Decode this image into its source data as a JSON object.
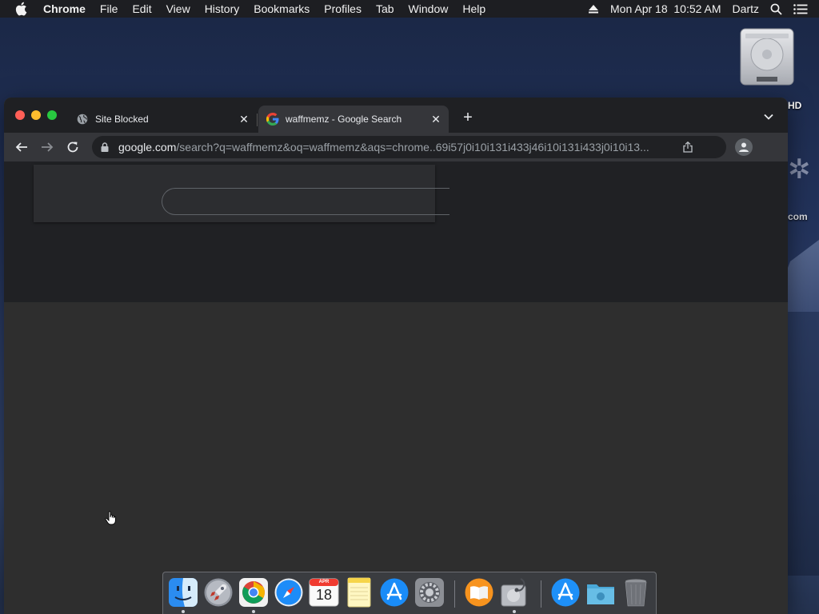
{
  "menubar": {
    "apple_icon": "apple-logo-icon",
    "items": [
      {
        "label": "Chrome",
        "app": true
      },
      {
        "label": "File"
      },
      {
        "label": "Edit"
      },
      {
        "label": "View"
      },
      {
        "label": "History"
      },
      {
        "label": "Bookmarks"
      },
      {
        "label": "Profiles"
      },
      {
        "label": "Tab"
      },
      {
        "label": "Window"
      },
      {
        "label": "Help"
      }
    ],
    "clock": "Mon Apr 18  10:52 AM",
    "user": "Dartz"
  },
  "desktop": {
    "drive_label": "HD",
    "partial_label": "com"
  },
  "browser": {
    "tabs": [
      {
        "title": "Site Blocked",
        "favicon": "globe-icon",
        "active": false
      },
      {
        "title": "waffmemz - Google Search",
        "favicon": "google-g-icon",
        "active": true
      }
    ],
    "omnibox": {
      "host": "google.com",
      "path": "/search?q=waffmemz&oq=waffmemz&aqs=chrome..69i57j0i10i131i433j46i10i131i433j0i10i13..."
    }
  },
  "dock": {
    "calendar_month": "APR",
    "calendar_day": "18",
    "items": [
      "finder",
      "launchpad",
      "chrome",
      "safari",
      "calendar",
      "notes",
      "app-store",
      "system-preferences",
      "books",
      "disk-utility",
      "app-store-downloads",
      "folder",
      "trash"
    ]
  },
  "colors": {
    "menubar": "#1d1e22",
    "tabstrip": "#1f2023",
    "toolbar": "#35363a",
    "omnibox": "#202124",
    "content": "#2e2e2e"
  }
}
